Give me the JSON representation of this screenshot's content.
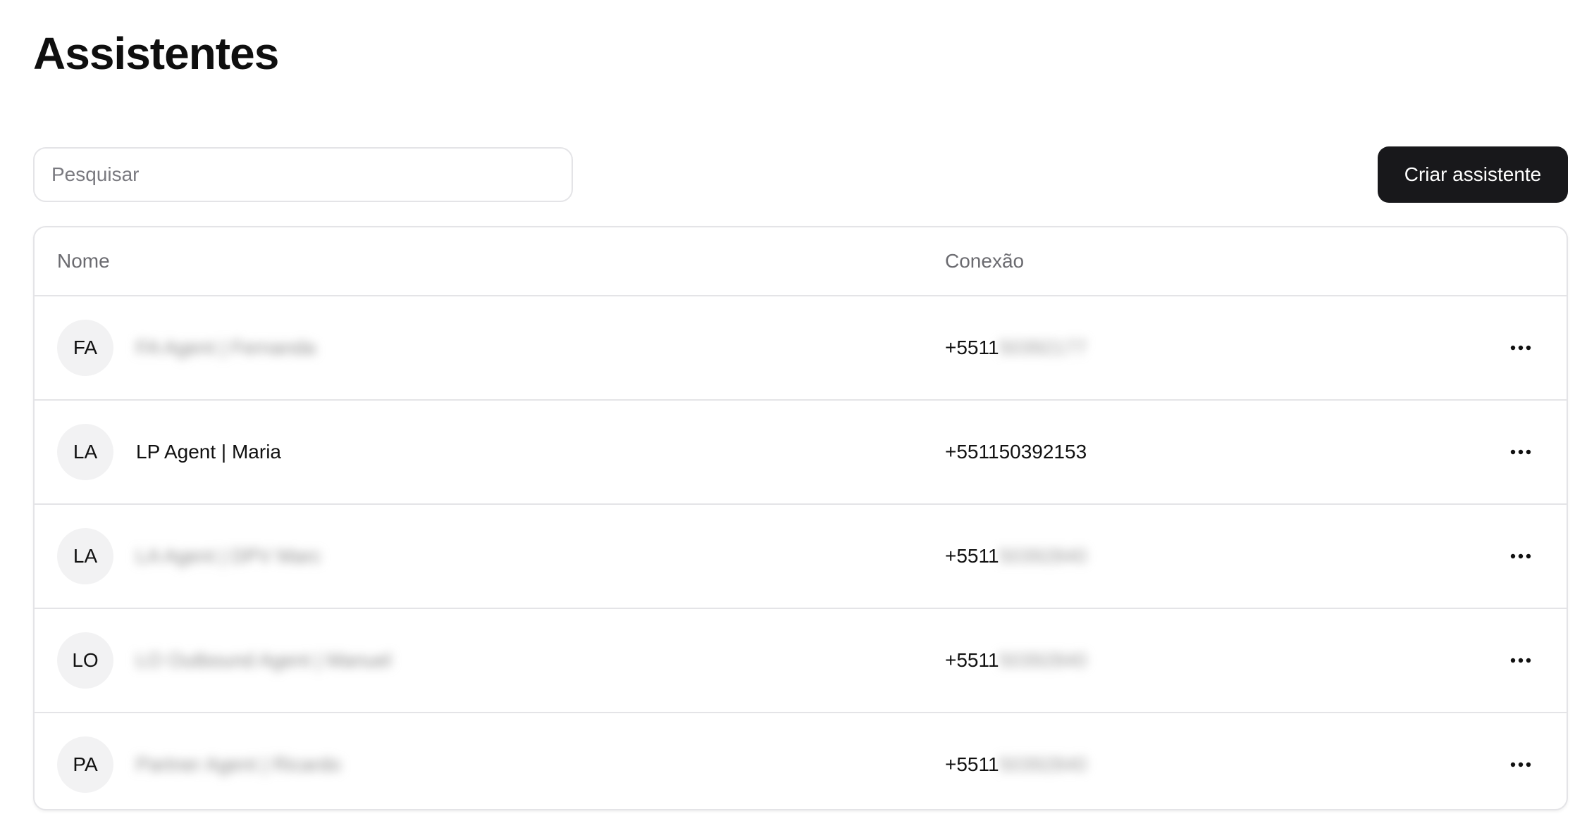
{
  "page": {
    "title": "Assistentes"
  },
  "toolbar": {
    "search_placeholder": "Pesquisar",
    "create_label": "Criar assistente"
  },
  "table": {
    "columns": [
      "Nome",
      "Conexão"
    ],
    "rows": [
      {
        "initials": "FA",
        "name": "FA Agent | Fernanda",
        "name_blurred": true,
        "connection_prefix": "+5511",
        "connection_rest": "50392177",
        "connection_blurred": true
      },
      {
        "initials": "LA",
        "name": "LP Agent | Maria",
        "name_blurred": false,
        "connection_prefix": "+551150392153",
        "connection_rest": "",
        "connection_blurred": false
      },
      {
        "initials": "LA",
        "name": "LA Agent | DPV Marc",
        "name_blurred": true,
        "connection_prefix": "+5511",
        "connection_rest": "50392840",
        "connection_blurred": true
      },
      {
        "initials": "LO",
        "name": "LO Outbound Agent | Manuel",
        "name_blurred": true,
        "connection_prefix": "+5511",
        "connection_rest": "50392840",
        "connection_blurred": true
      },
      {
        "initials": "PA",
        "name": "Partner Agent | Ricardo",
        "name_blurred": true,
        "connection_prefix": "+5511",
        "connection_rest": "50392840",
        "connection_blurred": true
      }
    ]
  },
  "icons": {
    "row_actions": "more-horizontal-icon"
  },
  "colors": {
    "primary_button": "#18181b",
    "border": "#e4e4e7",
    "avatar_bg": "#f2f2f3",
    "muted_text": "#6b6b70"
  }
}
